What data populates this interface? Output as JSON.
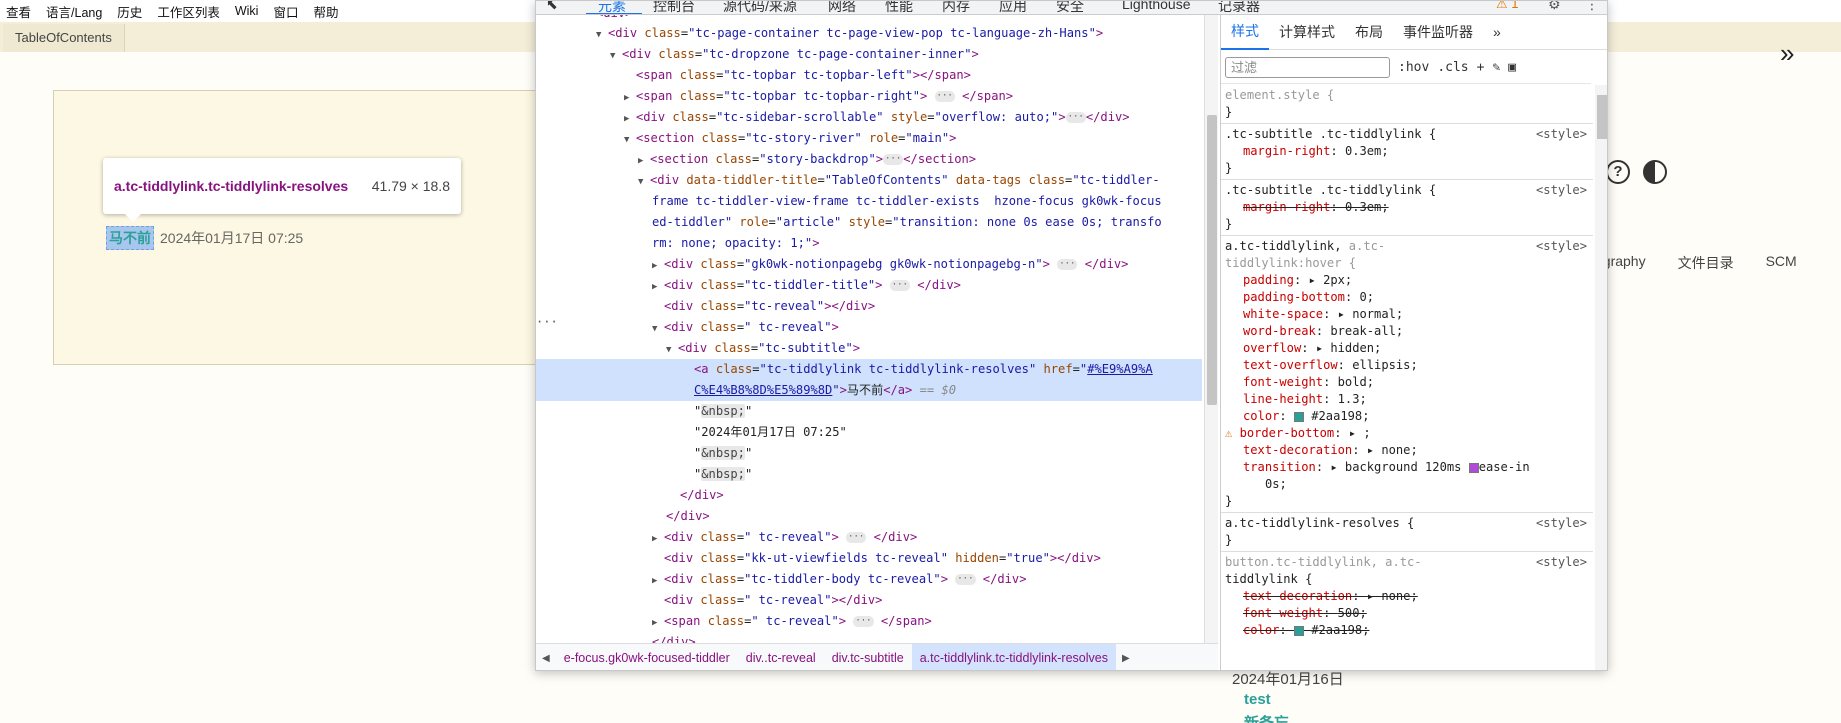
{
  "menubar": [
    "查看",
    "语言/Lang",
    "历史",
    "工作区列表",
    "Wiki",
    "窗口",
    "帮助"
  ],
  "page": {
    "tab_label": "TableOfContents",
    "subtitle_link": "马不前",
    "subtitle_date": "2024年01月17日 07:25",
    "right_nav": [
      "ography",
      "文件目录",
      "SCM"
    ],
    "side_date": "2024年01月16日",
    "side_items": [
      "test",
      "新备忘"
    ]
  },
  "tooltip": {
    "selector": "a.tc-tiddlylink.tc-tiddlylink-resolves",
    "size": "41.79 × 18.8"
  },
  "devtools": {
    "tabs": [
      "元素",
      "控制台",
      "源代码/来源",
      "网络",
      "性能",
      "内存",
      "应用",
      "安全",
      "Lighthouse",
      "记录器"
    ],
    "warning_count": "1",
    "dom": {
      "l0": "div",
      "l1_attr": "tc-page-container tc-page-view-pop tc-language-zh-Hans",
      "l2_attr": "tc-dropzone tc-page-container-inner",
      "l3_attr": "tc-topbar tc-topbar-left",
      "l4_attr": "tc-topbar tc-topbar-right",
      "l5_attr": "tc-sidebar-scrollable",
      "l5_style": "overflow: auto;",
      "l6_class": "tc-story-river",
      "l6_role": "main",
      "l7_attr": "story-backdrop",
      "l8_title": "TableOfContents",
      "l8_class_a": "tc-tiddler-",
      "l8_class_b": "frame tc-tiddler-view-frame tc-tiddler-exists  hzone-focus gk0wk-focus",
      "l8_class_c": "ed-tiddler",
      "l8_role": "article",
      "l8_style_a": "transition: none 0s ease 0s; transfo",
      "l8_style_b": "rm: none; opacity: 1;",
      "l9_attr": "gk0wk-notionpagebg gk0wk-notionpagebg-n",
      "l10_attr": "tc-tiddler-title",
      "l11_attr": "tc-reveal",
      "l12_attr": " tc-reveal",
      "l13_attr": "tc-subtitle",
      "l14_class": "tc-tiddlylink tc-tiddlylink-resolves",
      "l14_href_a": "#%E9%A9%A",
      "l14_href_b": "C%E4%B8%8D%E5%89%8D",
      "l14_text": "马不前",
      "l14_eq": "== $0",
      "nbsp": "&nbsp;",
      "date_text": "2024年01月17日 07:25",
      "l20_attr": " tc-reveal",
      "l21_attr": "kk-ut-viewfields tc-reveal",
      "l21_hidden": "true",
      "l22_attr": "tc-tiddler-body tc-reveal",
      "l23_attr": " tc-reveal",
      "l24_attr": " tc-reveal"
    },
    "breadcrumbs": [
      "e-focus.gk0wk-focused-tiddler",
      "div..tc-reveal",
      "div.tc-subtitle",
      "a.tc-tiddlylink.tc-tiddlylink-resolves"
    ],
    "styles_tabs": [
      "样式",
      "计算样式",
      "布局",
      "事件监听器"
    ],
    "filter_placeholder": "过滤",
    "filter_tools": [
      ":hov",
      ".cls"
    ],
    "rules": {
      "element_style": "element.style {",
      "r1_selector": ".tc-subtitle .tc-tiddlylink {",
      "r1_src": "<style>",
      "r1_prop": "margin-right",
      "r1_val": "0.3em;",
      "r2_selector": ".tc-subtitle .tc-tiddlylink {",
      "r2_src": "<style>",
      "r2_prop": "margin-right",
      "r2_val": "0.3em;",
      "r3_selector_a": "a.tc-tiddlylink,",
      "r3_selector_b": " a.tc-",
      "r3_selector_c": "tiddlylink:hover {",
      "r3_src": "<style>",
      "r3_props": [
        [
          "padding",
          "▸ 2px;"
        ],
        [
          "padding-bottom",
          "0;"
        ],
        [
          "white-space",
          "▸ normal;"
        ],
        [
          "word-break",
          "break-all;"
        ],
        [
          "overflow",
          "▸ hidden;"
        ],
        [
          "text-overflow",
          "ellipsis;"
        ],
        [
          "font-weight",
          "bold;"
        ],
        [
          "line-height",
          "1.3;"
        ],
        [
          "color",
          "#2aa198;"
        ],
        [
          "border-bottom",
          "▸ ;"
        ],
        [
          "text-decoration",
          "▸ none;"
        ],
        [
          "transition",
          "▸ background 120ms"
        ]
      ],
      "r3_transition_ease": "ease-in",
      "r3_transition_tail": "0s;",
      "r4_selector": "a.tc-tiddlylink-resolves {",
      "r4_src": "<style>",
      "r5_selector_a": "button.tc-tiddlylink, a.tc-",
      "r5_selector_b": "tiddlylink {",
      "r5_src": "<style>",
      "r5_props": [
        [
          "text-decoration",
          "▸ none;"
        ],
        [
          "font-weight",
          "500;"
        ],
        [
          "color",
          "#2aa198;"
        ]
      ]
    },
    "colors": {
      "tiddlylink": "#2aa198",
      "tag": "#881280",
      "attr_name": "#994500",
      "attr_value": "#1a1aa6",
      "accent": "#1a73e8"
    }
  }
}
